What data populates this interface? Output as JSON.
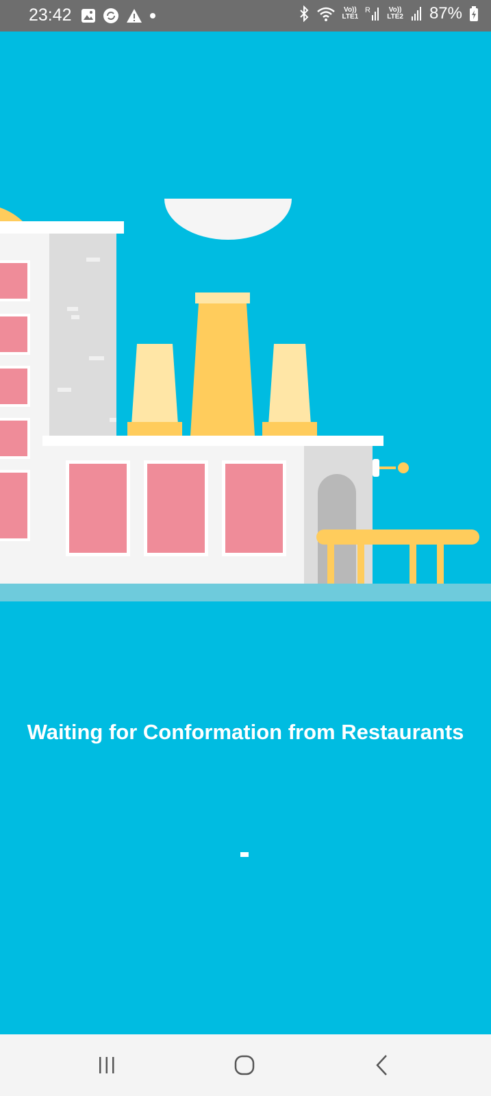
{
  "status_bar": {
    "time": "23:42",
    "battery": "87%",
    "sim1": "Vo))\nLTE1",
    "sim2": "Vo))\nLTE2",
    "icons_left": [
      "gallery-icon",
      "sync-icon",
      "warning-icon",
      "dot-icon"
    ],
    "icons_right": [
      "bluetooth-icon",
      "wifi-icon",
      "signal-icon",
      "battery-icon"
    ]
  },
  "main": {
    "message": "Waiting for Conformation from Restaurants"
  },
  "nav_bar": {
    "buttons": [
      "recents-button",
      "home-button",
      "back-button"
    ]
  },
  "colors": {
    "background": "#00BCE1",
    "status_bar": "#6E6E6E",
    "nav_bar": "#F4F4F4",
    "window_pink": "#EF8C99",
    "chimney_yellow": "#FFCC5C",
    "chimney_light": "#FFE6A6"
  }
}
